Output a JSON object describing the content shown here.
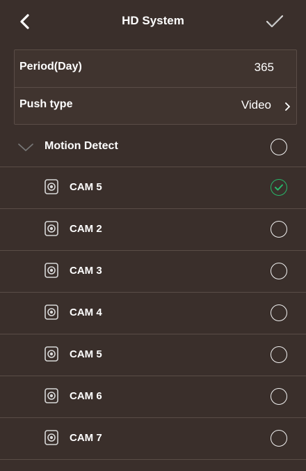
{
  "header": {
    "title": "HD System",
    "icons": {
      "back": "chevron-left-icon",
      "confirm": "checkmark-icon"
    }
  },
  "settings": {
    "period": {
      "label": "Period(Day)",
      "value": "365"
    },
    "push_type": {
      "label": "Push type",
      "value": "Video",
      "icon": "chevron-right-icon"
    }
  },
  "motion_detect": {
    "label": "Motion Detect",
    "expanded": true,
    "checked": false,
    "icon": "chevron-down-icon"
  },
  "cameras": [
    {
      "label": "CAM 5",
      "checked": true,
      "icon": "camera-icon"
    },
    {
      "label": "CAM 2",
      "checked": false,
      "icon": "camera-icon"
    },
    {
      "label": "CAM 3",
      "checked": false,
      "icon": "camera-icon"
    },
    {
      "label": "CAM 4",
      "checked": false,
      "icon": "camera-icon"
    },
    {
      "label": "CAM 5",
      "checked": false,
      "icon": "camera-icon"
    },
    {
      "label": "CAM 6",
      "checked": false,
      "icon": "camera-icon"
    },
    {
      "label": "CAM 7",
      "checked": false,
      "icon": "camera-icon"
    }
  ],
  "colors": {
    "background": "#3a2f2b",
    "divider": "#5a4d47",
    "text": "#ffffff",
    "checked": "#27b86a"
  }
}
